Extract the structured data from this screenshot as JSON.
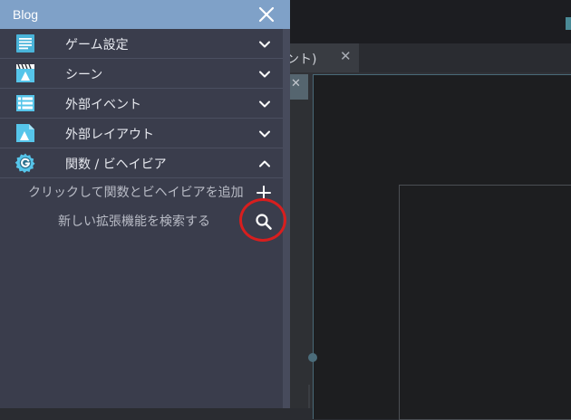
{
  "panel": {
    "title": "Blog",
    "sections": [
      {
        "label": "ゲーム設定",
        "icon": "game-settings-icon",
        "expanded": false
      },
      {
        "label": "シーン",
        "icon": "scene-icon",
        "expanded": false
      },
      {
        "label": "外部イベント",
        "icon": "external-events-icon",
        "expanded": false
      },
      {
        "label": "外部レイアウト",
        "icon": "external-layout-icon",
        "expanded": false
      },
      {
        "label": "関数 / ビヘイビア",
        "icon": "functions-behaviors-icon",
        "expanded": true
      }
    ],
    "actions": {
      "add_label": "クリックして関数とビヘイビアを追加",
      "search_label": "新しい拡張機能を検索する"
    }
  },
  "editor": {
    "scene_tab_label": "ベント)"
  },
  "colors": {
    "header": "#7fa1c8",
    "panel": "#3a3d4c",
    "highlight": "#d81e1e",
    "accent": "#4a8a96"
  }
}
